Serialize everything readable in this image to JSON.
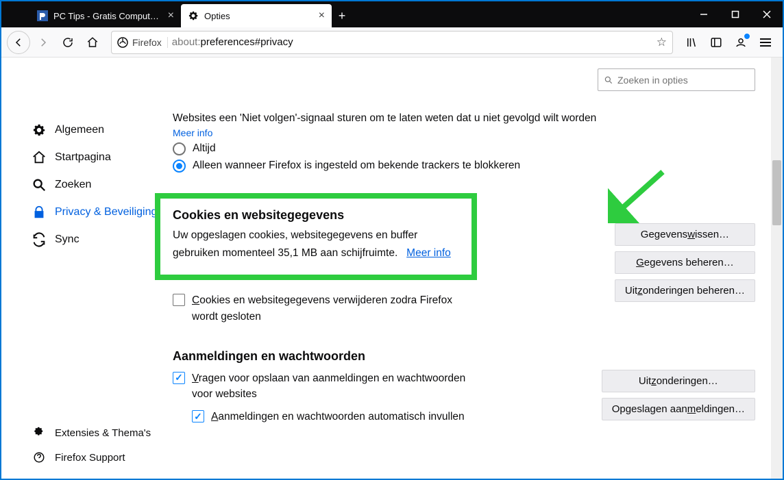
{
  "tabs": {
    "inactive": {
      "label": "PC Tips - Gratis Computer tips"
    },
    "active": {
      "label": "Opties"
    }
  },
  "urlbar": {
    "identity": "Firefox",
    "url_prefix": "about:",
    "url_rest": "preferences#privacy"
  },
  "sidebar": {
    "items": [
      {
        "label": "Algemeen"
      },
      {
        "label": "Startpagina"
      },
      {
        "label": "Zoeken"
      },
      {
        "label": "Privacy & Beveiliging"
      },
      {
        "label": "Sync"
      }
    ],
    "bottom": [
      {
        "label": "Extensies & Thema's"
      },
      {
        "label": "Firefox Support"
      }
    ]
  },
  "search": {
    "placeholder": "Zoeken in opties"
  },
  "dnt": {
    "desc": "Websites een 'Niet volgen'-signaal sturen om te laten weten dat u niet gevolgd wilt worden",
    "more": "Meer info",
    "opt_always": "Altijd",
    "opt_default": "Alleen wanneer Firefox is ingesteld om bekende trackers te blokkeren"
  },
  "cookies": {
    "title": "Cookies en websitegegevens",
    "desc_a": "Uw opgeslagen cookies, websitegegevens en buffer gebruiken momenteel 35,1 MB aan schijfruimte.",
    "more": "Meer info",
    "btn_clear_pre": "Gegevens ",
    "btn_clear_accel": "w",
    "btn_clear_post": "issen…",
    "btn_manage_accel": "G",
    "btn_manage_post": "egevens beheren…",
    "btn_exceptions_pre": "Uit",
    "btn_exceptions_accel": "z",
    "btn_exceptions_post": "onderingen beheren…",
    "chk_delete_accel": "C",
    "chk_delete_post": "ookies en websitegegevens verwijderen zodra Firefox wordt gesloten"
  },
  "logins": {
    "title": "Aanmeldingen en wachtwoorden",
    "chk_ask_accel": "V",
    "chk_ask_post": "ragen voor opslaan van aanmeldingen en wachtwoorden voor websites",
    "chk_autofill_accel": "A",
    "chk_autofill_post": "anmeldingen en wachtwoorden automatisch invullen",
    "btn_exceptions_pre": "Uit",
    "btn_exceptions_accel": "z",
    "btn_exceptions_post": "onderingen…",
    "btn_saved_pre": "Opgeslagen aan",
    "btn_saved_accel": "m",
    "btn_saved_post": "eldingen…"
  }
}
